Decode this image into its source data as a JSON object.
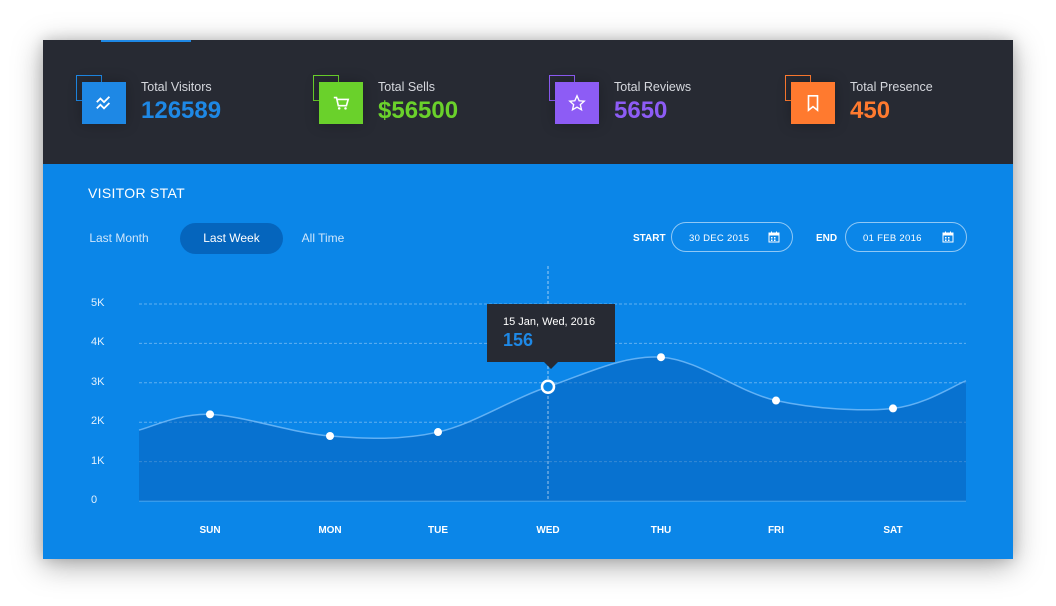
{
  "stats": [
    {
      "label": "Total Visitors",
      "value": "126589",
      "icon": "trend-icon",
      "color": "#1e88e5"
    },
    {
      "label": "Total Sells",
      "value": "$56500",
      "icon": "cart-icon",
      "color": "#6ad12b"
    },
    {
      "label": "Total Reviews",
      "value": "5650",
      "icon": "star-icon",
      "color": "#8d5cf5"
    },
    {
      "label": "Total Presence",
      "value": "450",
      "icon": "bookmark-icon",
      "color": "#ff7a2f"
    }
  ],
  "panel": {
    "title": "VISITOR STAT",
    "tabs": [
      "Last Month",
      "Last Week",
      "All Time"
    ],
    "active_tab": "Last Week",
    "start_label": "START",
    "start_value": "30 DEC  2015",
    "end_label": "END",
    "end_value": "01 FEB 2016"
  },
  "tooltip": {
    "date": "15 Jan, Wed, 2016",
    "value": "156"
  },
  "chart_data": {
    "type": "area",
    "categories": [
      "SUN",
      "MON",
      "TUE",
      "WED",
      "THU",
      "FRI",
      "SAT"
    ],
    "values": [
      2200,
      1650,
      1750,
      2900,
      3650,
      2550,
      2350
    ],
    "yticks": [
      "0",
      "1K",
      "2K",
      "3K",
      "4K",
      "5K"
    ],
    "ylim": [
      0,
      5000
    ],
    "highlight_category": "WED",
    "grid": true
  },
  "colors": {
    "panel": "#0b86e8",
    "top": "#272a33",
    "accent": "#1e88e5"
  }
}
